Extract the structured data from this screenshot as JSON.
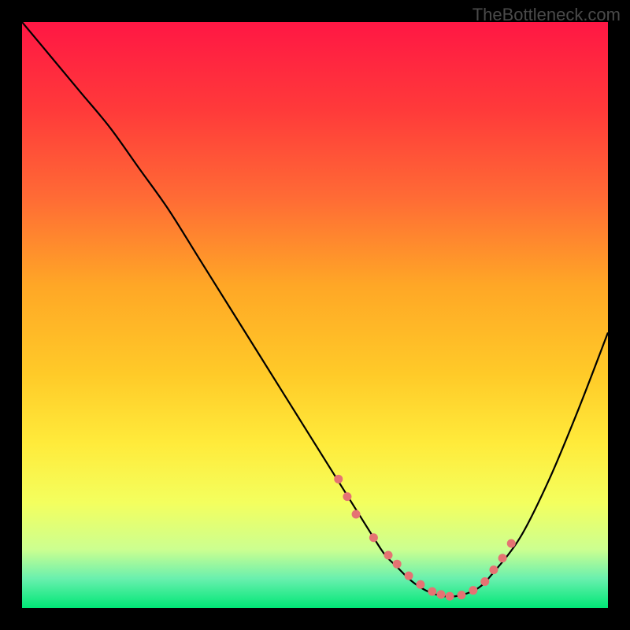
{
  "watermark": "TheBottleneck.com",
  "chart_data": {
    "type": "line",
    "title": "",
    "xlabel": "",
    "ylabel": "",
    "xlim": [
      0,
      100
    ],
    "ylim": [
      0,
      100
    ],
    "series": [
      {
        "name": "bottleneck-curve",
        "x": [
          0,
          5,
          10,
          15,
          20,
          25,
          30,
          35,
          40,
          45,
          50,
          55,
          60,
          62,
          64,
          66,
          68,
          70,
          72,
          74,
          76,
          78,
          80,
          85,
          90,
          95,
          100
        ],
        "y": [
          100,
          94,
          88,
          82,
          75,
          68,
          60,
          52,
          44,
          36,
          28,
          20,
          12,
          9,
          7,
          5,
          3.5,
          2.5,
          2,
          2,
          2.5,
          3.5,
          5.5,
          12,
          22,
          34,
          47
        ]
      }
    ],
    "markers": {
      "name": "highlight-points",
      "x": [
        54,
        55.5,
        57,
        60,
        62.5,
        64,
        66,
        68,
        70,
        71.5,
        73,
        75,
        77,
        79,
        80.5,
        82,
        83.5
      ],
      "y": [
        22,
        19,
        16,
        12,
        9,
        7.5,
        5.5,
        4,
        2.8,
        2.3,
        2,
        2.2,
        3,
        4.5,
        6.5,
        8.5,
        11
      ]
    },
    "gradient_stops": [
      {
        "offset": 0,
        "color": "#ff1744"
      },
      {
        "offset": 15,
        "color": "#ff3a3a"
      },
      {
        "offset": 30,
        "color": "#ff6b35"
      },
      {
        "offset": 45,
        "color": "#ffa726"
      },
      {
        "offset": 60,
        "color": "#ffca28"
      },
      {
        "offset": 72,
        "color": "#ffeb3b"
      },
      {
        "offset": 82,
        "color": "#f4ff5e"
      },
      {
        "offset": 90,
        "color": "#ccff90"
      },
      {
        "offset": 95,
        "color": "#69f0ae"
      },
      {
        "offset": 100,
        "color": "#00e676"
      }
    ],
    "marker_color": "#e57373"
  }
}
